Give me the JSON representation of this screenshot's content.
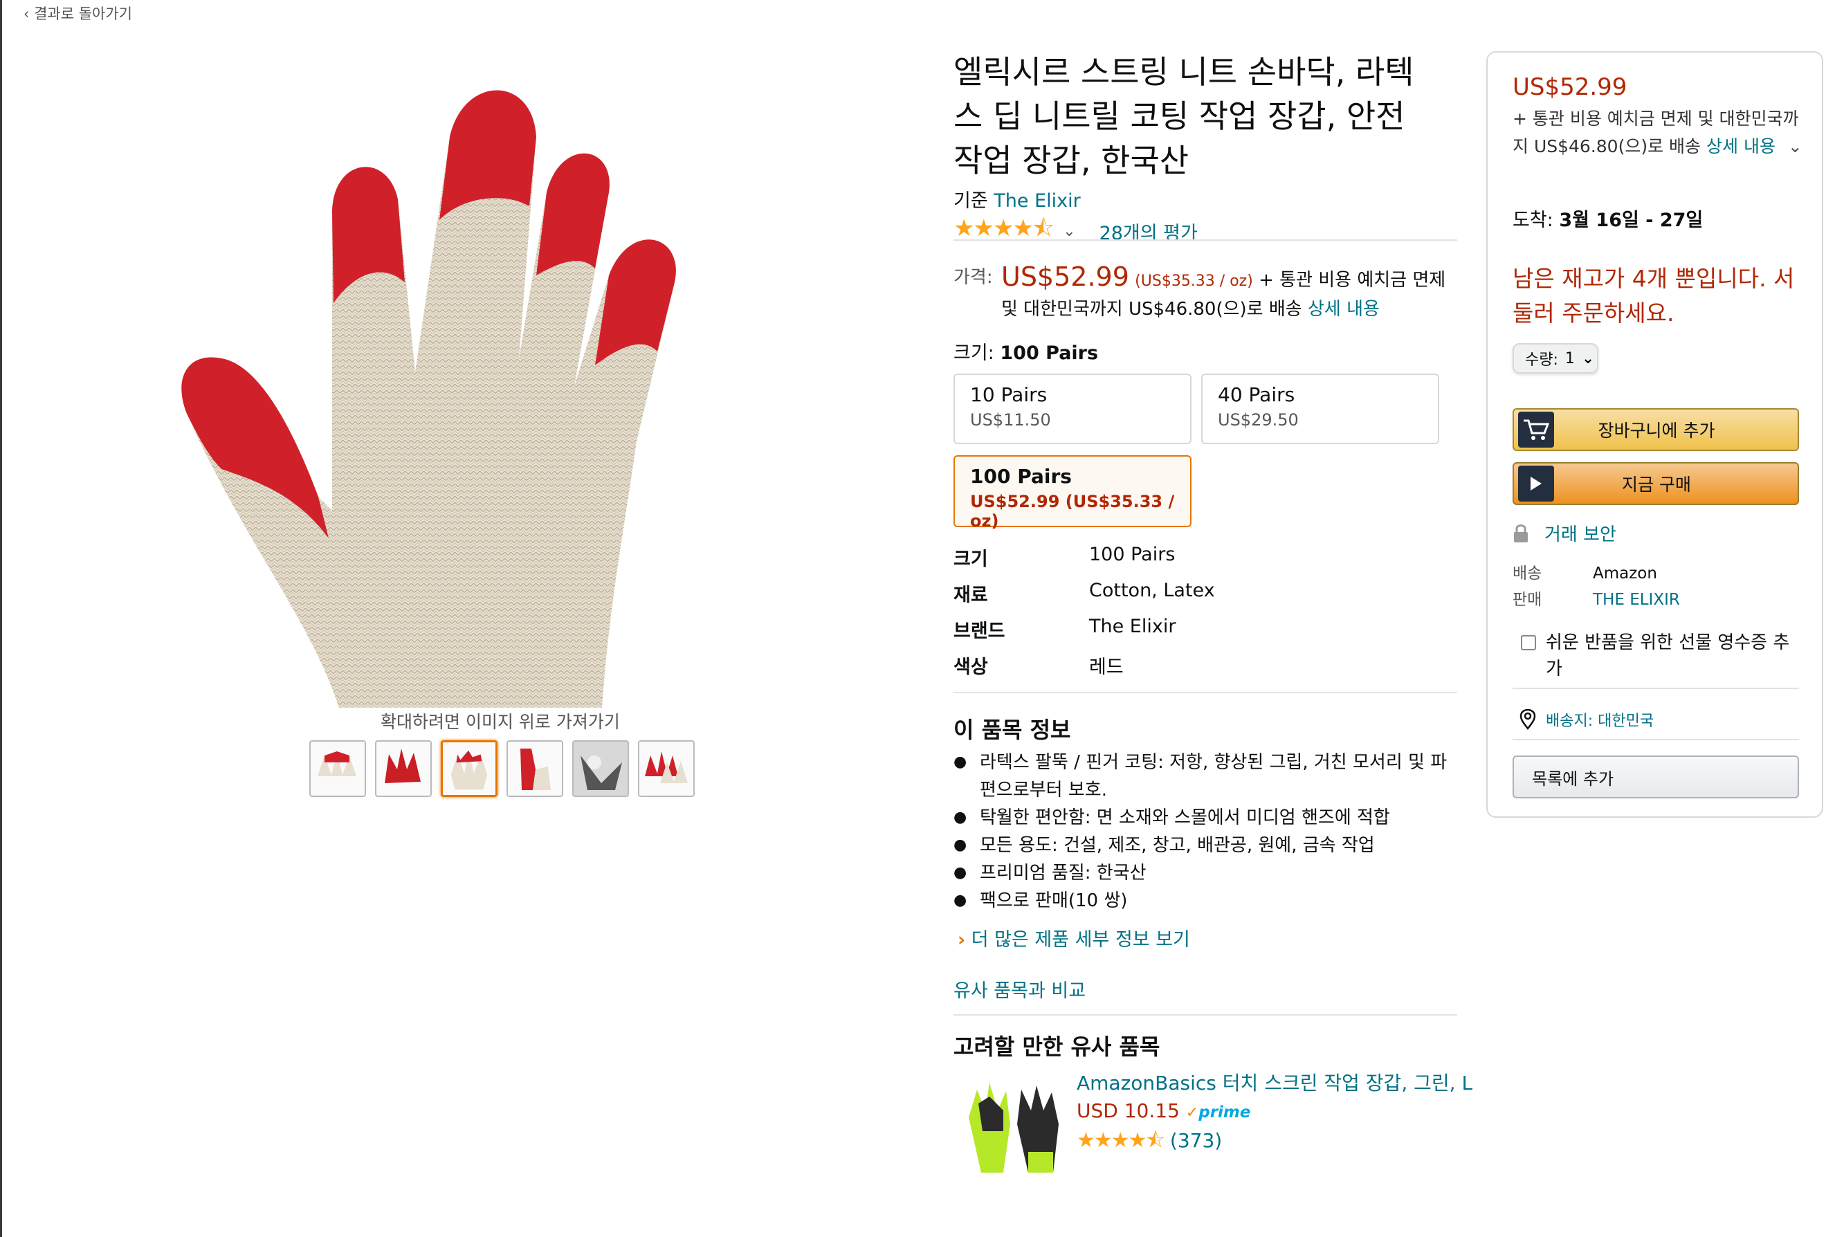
{
  "nav": {
    "back_label": "‹  결과로 돌아가기"
  },
  "gallery": {
    "zoom_hint": "확대하려면 이미지 위로 가져가기",
    "thumbnail_count": 6,
    "selected_index": 2
  },
  "product": {
    "title": "엘릭시르 스트링 니트 손바닥, 라텍스 딥 니트릴 코팅 작업 장갑, 안전 작업 장갑, 한국산",
    "by_prefix": "기준 ",
    "brand_link": "The Elixir",
    "stars": "★★★★⯪",
    "rating_count": "28개의 평가",
    "price_label": "가격:",
    "price": "US$52.99",
    "unit_price": "(US$35.33 / oz)",
    "shipping_note": "+ 통관 비용 예치금 면제 및 대한민국까지 US$46.80(으)로 배송",
    "details_link": "상세 내용",
    "size_label": "크기:",
    "size_selected": "100 Pairs",
    "size_options": [
      {
        "name": "10 Pairs",
        "price": "US$11.50"
      },
      {
        "name": "40 Pairs",
        "price": "US$29.50"
      },
      {
        "name": "100 Pairs",
        "price": "US$52.99 (US$35.33 / oz)"
      }
    ],
    "specs": [
      {
        "key": "크기",
        "value": "100 Pairs"
      },
      {
        "key": "재료",
        "value": "Cotton, Latex"
      },
      {
        "key": "브랜드",
        "value": "The Elixir"
      },
      {
        "key": "색상",
        "value": "레드"
      }
    ],
    "about_title": "이 품목 정보",
    "bullets": [
      "라텍스 팔뚝 / 핀거 코팅: 저항, 향상된 그립, 거친 모서리 및 파편으로부터 보호.",
      "탁월한 편안함: 면 소재와 스몰에서 미디엄 핸즈에 적합",
      "모든 용도: 건설, 제조, 창고, 배관공, 원예, 금속 작업",
      "프리미엄 품질: 한국산",
      "팩으로 판매(10 쌍)"
    ],
    "more_details": "더 많은 제품 세부 정보 보기",
    "compare_link": "유사 품목과 비교",
    "similar_title": "고려할 만한 유사 품목",
    "similar": {
      "name": "AmazonBasics 터치 스크린 작업 장갑, 그린, L",
      "price": "USD 10.15",
      "prime": "prime",
      "stars": "★★★★⯪",
      "reviews": "(373)"
    }
  },
  "buybox": {
    "price": "US$52.99",
    "ship_text": "+ 통관 비용 예치금 면제 및 대한민국까지 US$46.80(으)로 배송",
    "details_link": "상세 내용",
    "arrival_label": "도착:",
    "arrival_date": "3월 16일 - 27일",
    "stock_notice": "남은 재고가 4개 뿐입니다. 서둘러 주문하세요.",
    "qty_label": "수량:",
    "qty_value": "1",
    "add_to_cart": "장바구니에 추가",
    "buy_now": "지금 구매",
    "secure": "거래 보안",
    "ships_from_label": "배송",
    "ships_from": "Amazon",
    "sold_by_label": "판매",
    "sold_by": "THE ELIXIR",
    "gift_receipt": "쉬운 반품을 위한 선물 영수증 추가",
    "deliver_to": "배송지: 대한민국",
    "add_to_list": "목록에 추가"
  },
  "colors": {
    "price_red": "#B12704",
    "link_teal": "#007185",
    "star_orange": "#FFA41C",
    "cart_yellow": "#f0c14b",
    "buy_orange": "#ed9220"
  }
}
